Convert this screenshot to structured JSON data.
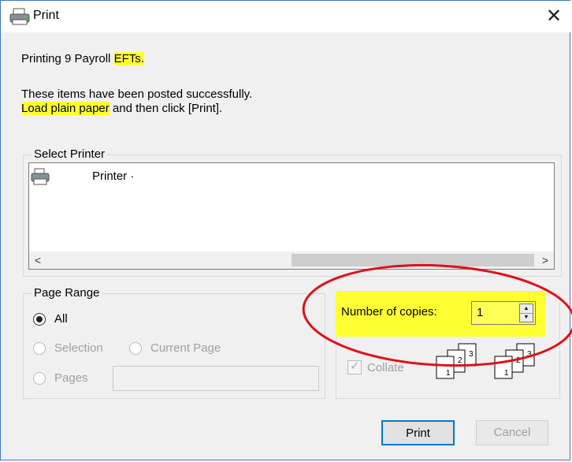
{
  "window": {
    "title": "Print",
    "close_glyph": "✕"
  },
  "message": {
    "line1_prefix": "Printing 9 Payroll ",
    "line1_highlight": "EFTs.",
    "line2": "These items have been posted successfully.",
    "line3_highlight": "Load plain paper",
    "line3_suffix": " and then click [Print]."
  },
  "select_printer": {
    "legend": "Select Printer",
    "printers": [
      {
        "name": "Printer ·",
        "icon": "printer-icon"
      }
    ],
    "scroll_left": "<",
    "scroll_right": ">"
  },
  "page_range": {
    "legend": "Page Range",
    "options": {
      "all": "All",
      "selection": "Selection",
      "current_page": "Current Page",
      "pages": "Pages"
    },
    "selected": "All",
    "pages_value": ""
  },
  "copies": {
    "label": "Number of copies:",
    "value": "1",
    "collate_label": "Collate",
    "collate_checked": true
  },
  "buttons": {
    "print": "Print",
    "cancel": "Cancel"
  },
  "colors": {
    "highlight": "#ffff33",
    "annotation_circle": "#e0101a",
    "default_button_border": "#0078d7"
  }
}
